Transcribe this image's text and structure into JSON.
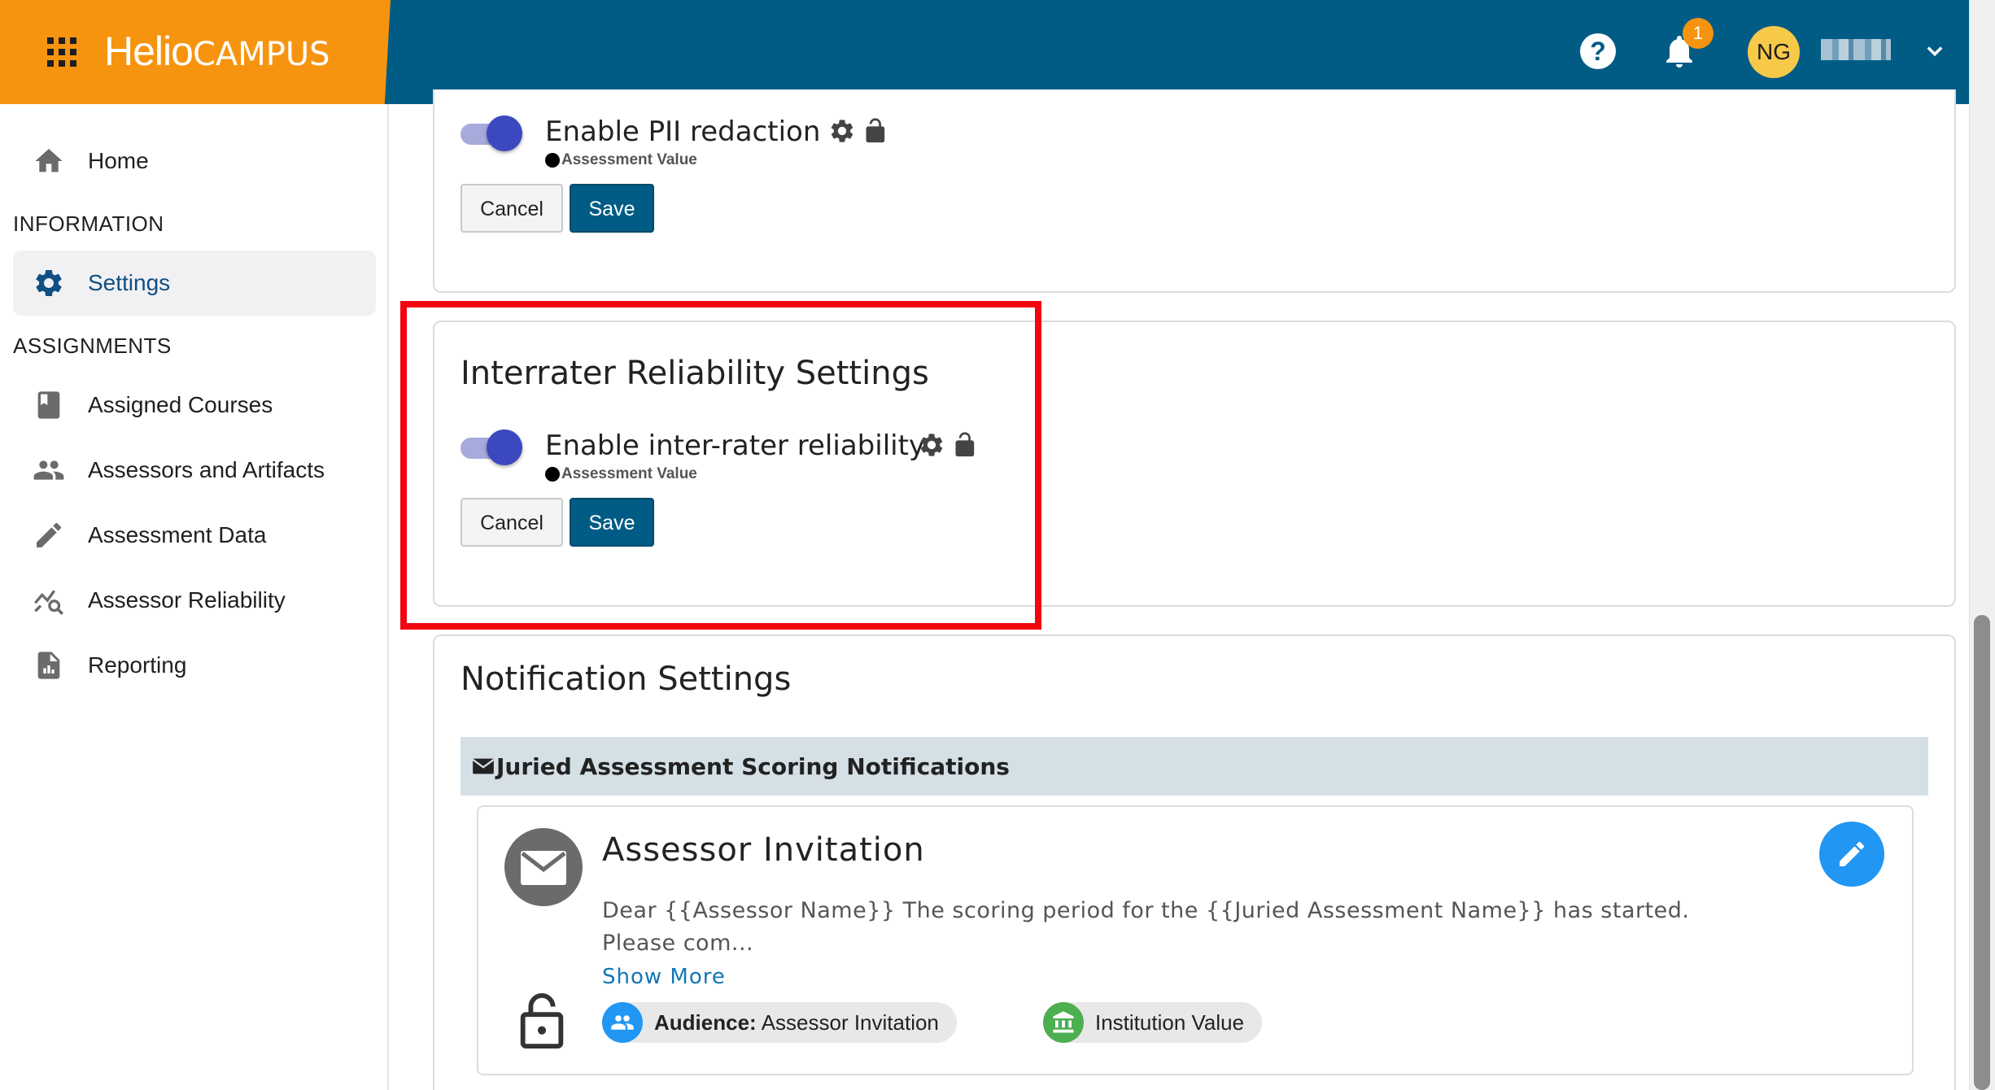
{
  "header": {
    "brand_part1": "Helio",
    "brand_part2": "CAMPUS",
    "help_symbol": "?",
    "notification_count": "1",
    "user_initials": "NG"
  },
  "sidebar": {
    "home": "Home",
    "section_information": "INFORMATION",
    "settings": "Settings",
    "section_assignments": "ASSIGNMENTS",
    "items": [
      {
        "label": "Assigned Courses",
        "icon": "book-icon"
      },
      {
        "label": "Assessors and Artifacts",
        "icon": "people-icon"
      },
      {
        "label": "Assessment Data",
        "icon": "pencil-icon"
      },
      {
        "label": "Assessor Reliability",
        "icon": "reliability-chart-icon"
      },
      {
        "label": "Reporting",
        "icon": "report-icon"
      }
    ]
  },
  "pii": {
    "label": "Enable PII redaction",
    "value_source": "Assessment Value",
    "enabled": true,
    "cancel": "Cancel",
    "save": "Save"
  },
  "interrater": {
    "title": "Interrater Reliability Settings",
    "label": "Enable inter-rater reliability",
    "value_source": "Assessment Value",
    "enabled": true,
    "cancel": "Cancel",
    "save": "Save"
  },
  "notifications": {
    "title": "Notification Settings",
    "group_title": "Juried Assessment Scoring Notifications",
    "card": {
      "title": "Assessor Invitation",
      "body": "Dear {{Assessor Name}} The scoring period for the {{Juried Assessment Name}} has started. Please com...",
      "show_more": "Show More",
      "audience_label": "Audience:",
      "audience_value": "Assessor Invitation",
      "scope": "Institution Value"
    }
  },
  "colors": {
    "header_bg": "#005c85",
    "brand_orange": "#f7940f",
    "toggle_on": "#3b48c0",
    "highlight": "#f2050f",
    "fab_blue": "#2196f3",
    "audience_icon_bg": "#2196f3",
    "scope_icon_bg": "#4caf50"
  }
}
